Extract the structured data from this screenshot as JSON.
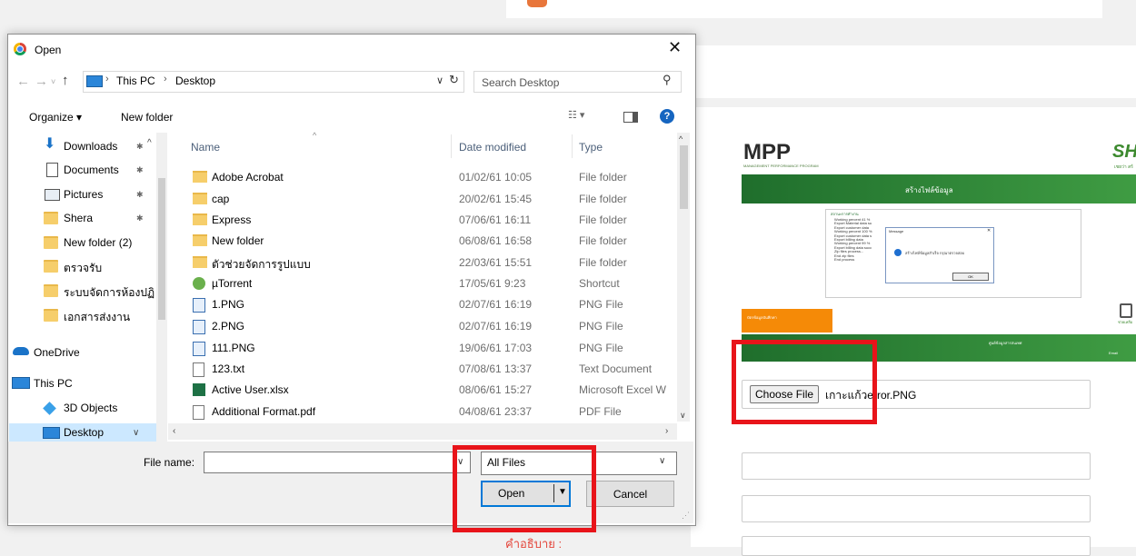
{
  "dialog": {
    "title": "Open",
    "close_glyph": "✕",
    "address": {
      "segments": [
        "This PC",
        "Desktop"
      ],
      "separator": "›"
    },
    "search_placeholder": "Search Desktop",
    "toolbar": {
      "organize": "Organize ▾",
      "new_folder": "New folder",
      "help": "?"
    },
    "nav_items": [
      {
        "label": "Downloads",
        "icon": "download-icon"
      },
      {
        "label": "Documents",
        "icon": "documents-icon"
      },
      {
        "label": "Pictures",
        "icon": "pictures-icon"
      },
      {
        "label": "Shera",
        "icon": "folder-icon"
      },
      {
        "label": "New folder (2)",
        "icon": "folder-icon"
      },
      {
        "label": "ตรวจรับ",
        "icon": "folder-icon"
      },
      {
        "label": "ระบบจัดการห้องปฏิ",
        "icon": "folder-icon"
      },
      {
        "label": "เอกสารส่งงาน",
        "icon": "folder-icon"
      },
      {
        "label": "OneDrive",
        "icon": "cloud-icon"
      },
      {
        "label": "This PC",
        "icon": "computer-icon"
      },
      {
        "label": "3D Objects",
        "icon": "cube-icon"
      },
      {
        "label": "Desktop",
        "icon": "desktop-icon"
      }
    ],
    "columns": {
      "name": "Name",
      "date": "Date modified",
      "type": "Type"
    },
    "files": [
      {
        "name": "Adobe Acrobat",
        "date": "01/02/61 10:05",
        "type": "File folder",
        "kind": "folder"
      },
      {
        "name": "cap",
        "date": "20/02/61 15:45",
        "type": "File folder",
        "kind": "folder"
      },
      {
        "name": "Express",
        "date": "07/06/61 16:11",
        "type": "File folder",
        "kind": "folder"
      },
      {
        "name": "New folder",
        "date": "06/08/61 16:58",
        "type": "File folder",
        "kind": "folder"
      },
      {
        "name": "ตัวช่วยจัดการรูปแบบ",
        "date": "22/03/61 15:51",
        "type": "File folder",
        "kind": "folder"
      },
      {
        "name": "µTorrent",
        "date": "17/05/61 9:23",
        "type": "Shortcut",
        "kind": "shortcut"
      },
      {
        "name": "1.PNG",
        "date": "02/07/61 16:19",
        "type": "PNG File",
        "kind": "png"
      },
      {
        "name": "2.PNG",
        "date": "02/07/61 16:19",
        "type": "PNG File",
        "kind": "png"
      },
      {
        "name": "111.PNG",
        "date": "19/06/61 17:03",
        "type": "PNG File",
        "kind": "png"
      },
      {
        "name": "123.txt",
        "date": "07/08/61 13:37",
        "type": "Text Document",
        "kind": "txt"
      },
      {
        "name": "Active User.xlsx",
        "date": "08/06/61 15:27",
        "type": "Microsoft Excel W",
        "kind": "xlsx"
      },
      {
        "name": "Additional Format.pdf",
        "date": "04/08/61 23:37",
        "type": "PDF File",
        "kind": "pdf"
      }
    ],
    "file_name_label": "File name:",
    "file_name_value": "",
    "filter": "All Files",
    "open_button": "Open",
    "cancel_button": "Cancel"
  },
  "page": {
    "preview": {
      "logo": "MPP",
      "logo_sub": "MANAGEMENT PERFORMANCE PROGRAM",
      "brand": "SH",
      "brand_sub": "เชยว่า สร้",
      "header_title": "สร้างไฟล์ข้อมูล",
      "panel_title": "สถานะการทำงาน",
      "log_lines": [
        "Working percent 41 %",
        "Export Material data su",
        "Export customer data",
        "Working percent 100 %",
        "Export customer data s",
        "Export billing data",
        "Working percent 99 %",
        "Export billing data succ",
        "Zip files process...",
        "End zip files",
        "End process"
      ],
      "message_title": "Message",
      "message_close": "✕",
      "message_text": "สร้างไฟล์ข้อมูลสำเร็จ กรุณาตรวจสอบ",
      "message_ok": "OK",
      "orange_label": "บัตรข้อมูลบันทึกค่า",
      "footer_text": "ศูนย์ข้อมูลสารสนเทศ",
      "footer_text2": "Email",
      "side_label": "ช่วยเหลือ"
    },
    "choose_file_button": "Choose File",
    "chosen_file_name": "เกาะแก้วerror.PNG",
    "description_label": "คำอธิบาย :"
  },
  "colors": {
    "highlight_red": "#e8141a",
    "accent_blue": "#0078d7",
    "brand_green": "#2e8b3a"
  }
}
